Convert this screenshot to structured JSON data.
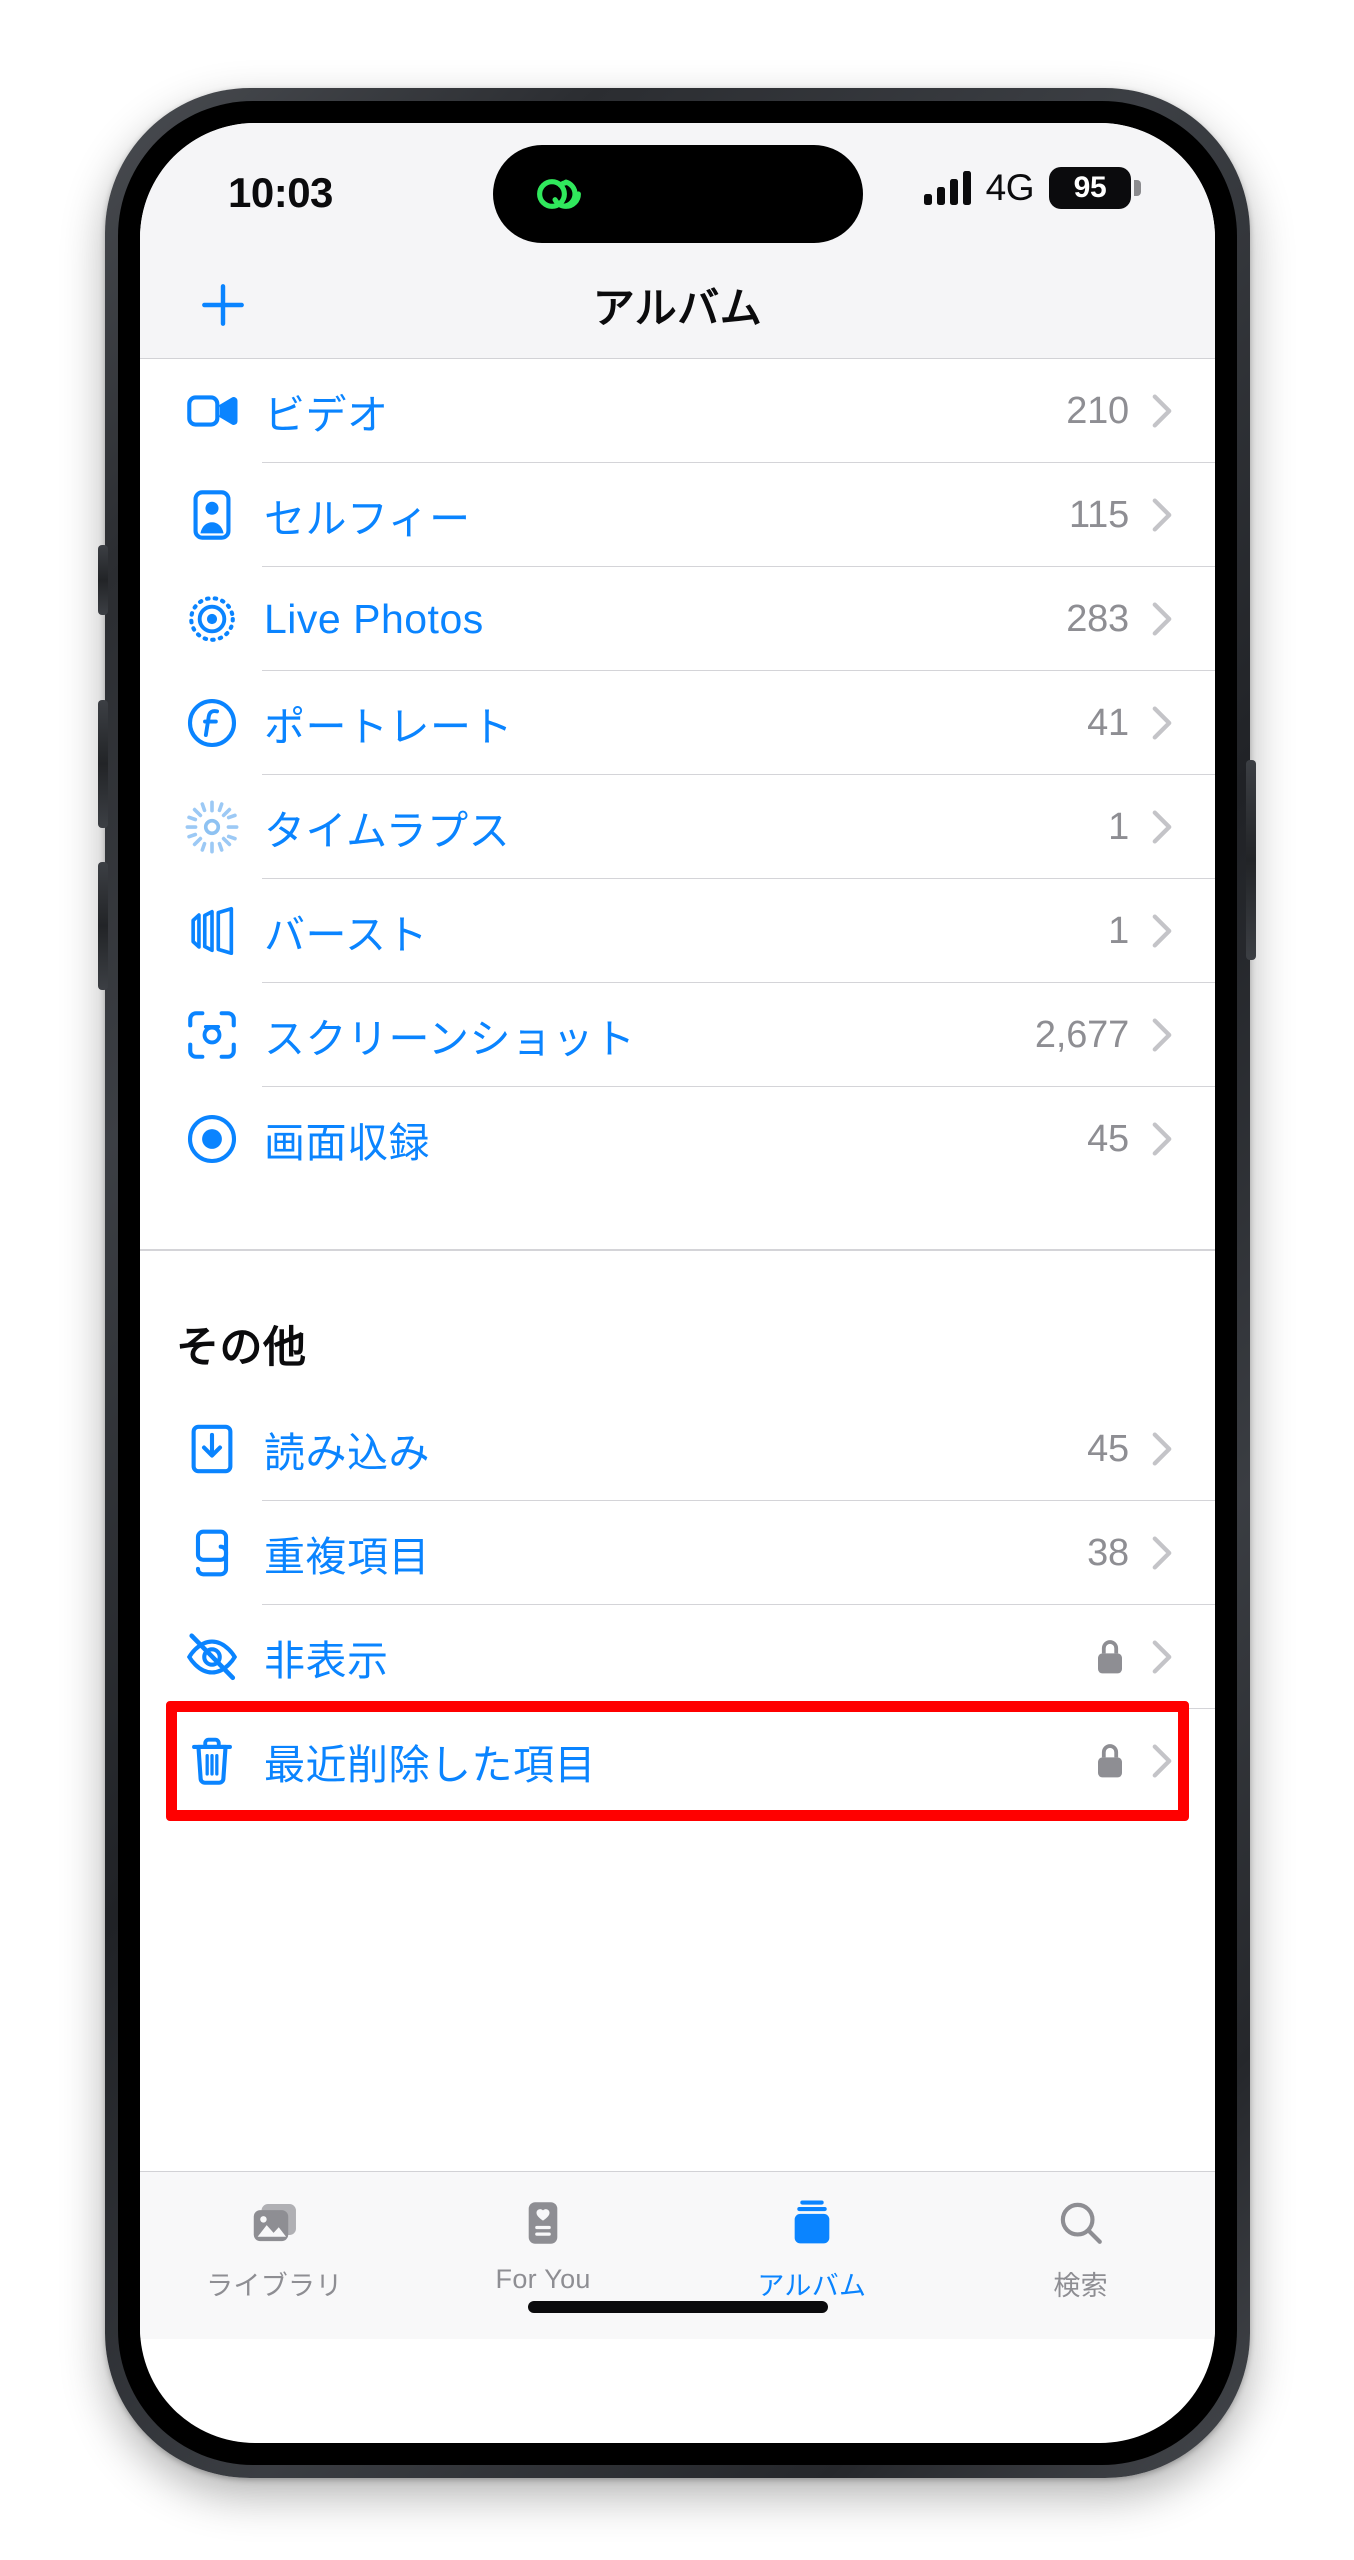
{
  "status_bar": {
    "time": "10:03",
    "island_icon": "link-chain-icon",
    "island_icon_color": "#30e85c",
    "signal_icon": "cellular-signal-icon",
    "network": "4G",
    "battery_percent": "95"
  },
  "nav_bar": {
    "add_icon": "plus-icon",
    "title": "アルバム"
  },
  "media_types": [
    {
      "icon": "video-camera-icon",
      "label": "ビデオ",
      "count": "210"
    },
    {
      "icon": "selfie-person-icon",
      "label": "セルフィー",
      "count": "115"
    },
    {
      "icon": "live-photos-icon",
      "label": "Live Photos",
      "count": "283"
    },
    {
      "icon": "portrait-f-icon",
      "label": "ポートレート",
      "count": "41"
    },
    {
      "icon": "timelapse-icon",
      "label": "タイムラプス",
      "count": "1"
    },
    {
      "icon": "burst-icon",
      "label": "バースト",
      "count": "1"
    },
    {
      "icon": "screenshot-icon",
      "label": "スクリーンショット",
      "count": "2,677"
    },
    {
      "icon": "screen-record-icon",
      "label": "画面収録",
      "count": "45"
    }
  ],
  "other_section": {
    "header": "その他",
    "items": [
      {
        "icon": "import-icon",
        "label": "読み込み",
        "count": "45",
        "locked": false
      },
      {
        "icon": "duplicate-icon",
        "label": "重複項目",
        "count": "38",
        "locked": false
      },
      {
        "icon": "eye-slash-icon",
        "label": "非表示",
        "count": "",
        "locked": true
      },
      {
        "icon": "trash-icon",
        "label": "最近削除した項目",
        "count": "",
        "locked": true
      }
    ]
  },
  "highlight": {
    "target_label": "最近削除した項目",
    "color": "#ff0000"
  },
  "tab_bar": {
    "tabs": [
      {
        "icon": "photos-library-icon",
        "label": "ライブラリ",
        "active": false
      },
      {
        "icon": "for-you-card-icon",
        "label": "For You",
        "active": false
      },
      {
        "icon": "albums-stack-icon",
        "label": "アルバム",
        "active": true
      },
      {
        "icon": "search-magnifier-icon",
        "label": "検索",
        "active": false
      }
    ]
  },
  "colors": {
    "accent": "#0a84ff",
    "secondary_text": "#8e8e93",
    "highlight": "#ff0000",
    "island_green": "#30e85c"
  }
}
